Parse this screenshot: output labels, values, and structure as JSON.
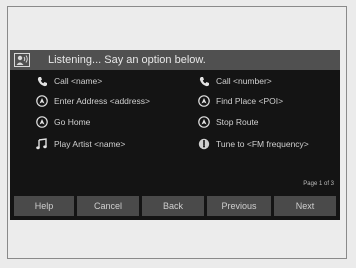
{
  "header": {
    "text": "Listening... Say an option below."
  },
  "options": [
    {
      "label": "Call <name>",
      "icon": "phone-icon"
    },
    {
      "label": "Call <number>",
      "icon": "phone-icon"
    },
    {
      "label": "Enter Address <address>",
      "icon": "navigation-icon"
    },
    {
      "label": "Find Place <POI>",
      "icon": "navigation-icon"
    },
    {
      "label": "Go Home",
      "icon": "navigation-icon"
    },
    {
      "label": "Stop Route",
      "icon": "navigation-icon"
    },
    {
      "label": "Play Artist <name>",
      "icon": "music-note-icon"
    },
    {
      "label": "Tune to <FM frequency>",
      "icon": "radio-tuner-icon"
    }
  ],
  "page_indicator": "Page 1 of 3",
  "buttons": {
    "help": "Help",
    "cancel": "Cancel",
    "back": "Back",
    "previous": "Previous",
    "next": "Next"
  },
  "colors": {
    "screen_background": "#141414",
    "header_background": "#505050",
    "button_background": "#4a4a4a",
    "text": "#d0d0d0"
  }
}
